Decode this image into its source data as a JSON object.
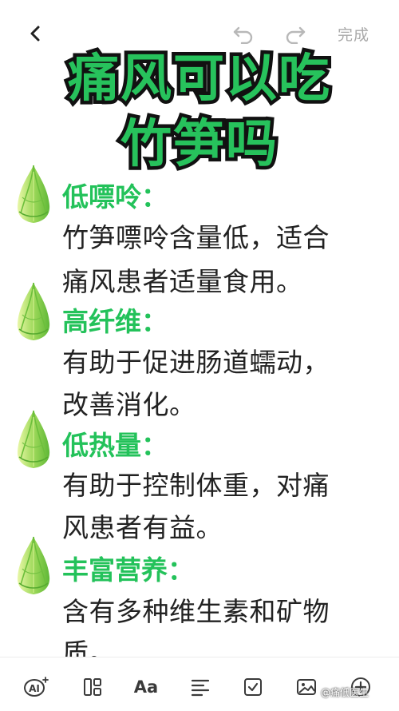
{
  "topbar": {
    "back_icon": "chevron-left-icon",
    "undo_icon": "undo-icon",
    "redo_icon": "redo-icon",
    "done_label": "完成"
  },
  "title": {
    "line1": "痛风可以吃",
    "line2": "竹笋吗"
  },
  "sections": [
    {
      "heading": "低嘌呤：",
      "lines": [
        "竹笋嘌呤含量低，适合",
        "痛风患者适量食用。"
      ]
    },
    {
      "heading": "高纤维：",
      "lines": [
        "有助于促进肠道蠕动，",
        "改善消化。"
      ]
    },
    {
      "heading": "低热量：",
      "lines": [
        "有助于控制体重，对痛",
        "风患者有益。"
      ]
    },
    {
      "heading": "丰富营养：",
      "lines": [
        "含有多种维生素和矿物",
        "质。"
      ]
    }
  ],
  "colors": {
    "accent_green": "#23c25a",
    "title_outline": "#111111",
    "body_text": "#222222",
    "toolbar_icon": "#3a3a3a"
  },
  "bottombar": {
    "ai_label": "AI",
    "ai_icon": "ai-assistant-icon",
    "layout_icon": "layout-icon",
    "text_style_label": "Aa",
    "align_icon": "align-left-icon",
    "checklist_icon": "checkbox-icon",
    "image_icon": "image-icon",
    "add_icon": "add-icon"
  },
  "watermark": "@痛低医生"
}
